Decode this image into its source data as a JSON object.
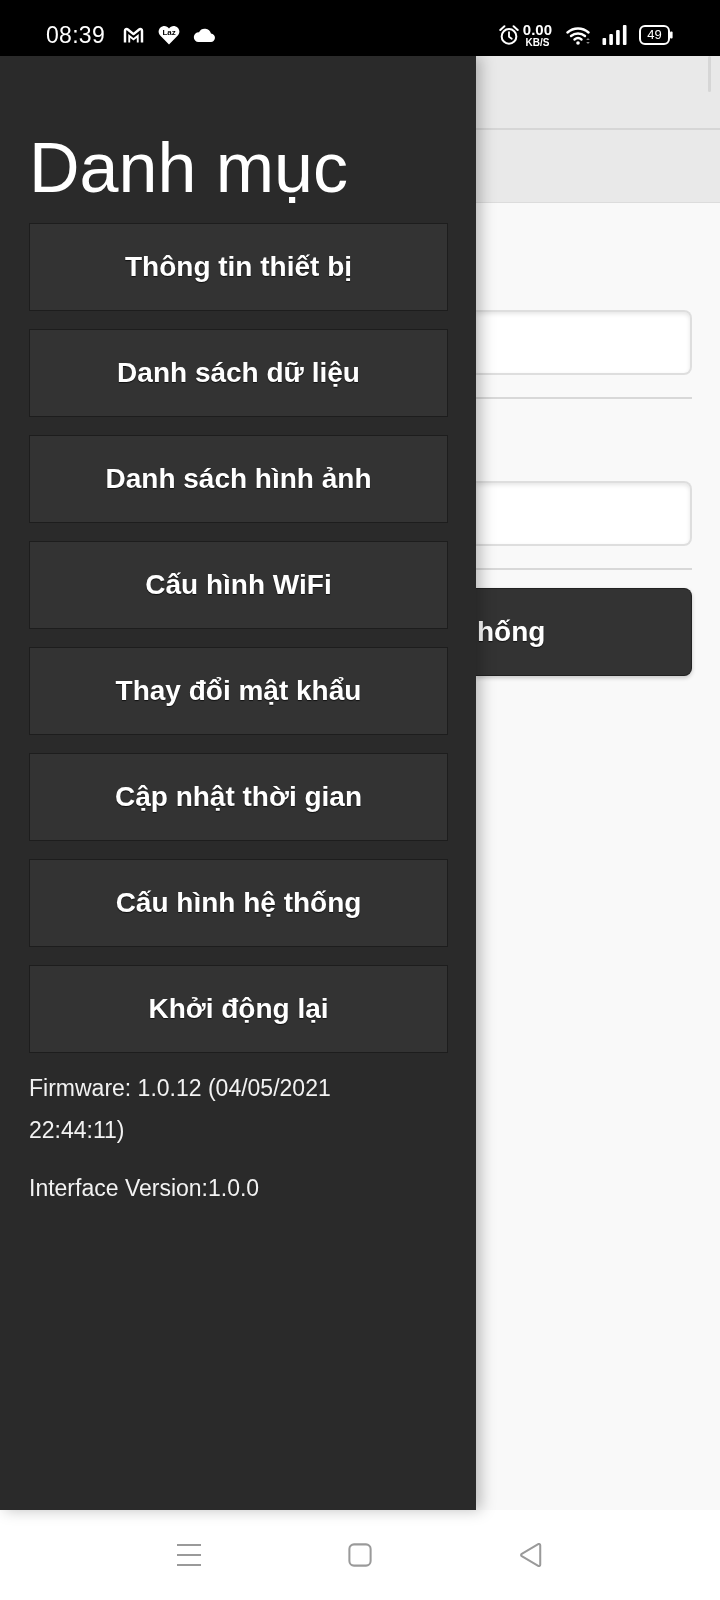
{
  "status_bar": {
    "time": "08:39",
    "notification_logo": "Laz",
    "network_speed": "0.00",
    "network_speed_unit": "KB/S",
    "battery": "49"
  },
  "drawer": {
    "title": "Danh mục",
    "items": [
      "Thông tin thiết bị",
      "Danh sách dữ liệu",
      "Danh sách hình ảnh",
      "Cấu hình WiFi",
      "Thay đổi mật khẩu",
      "Cập nhật thời gian",
      "Cấu hình hệ thống",
      "Khởi động lại"
    ],
    "firmware": "Firmware: 1.0.12 (04/05/2021 22:44:11)",
    "interface_version": "Interface Version:1.0.0"
  },
  "background_page": {
    "button": "hống"
  }
}
